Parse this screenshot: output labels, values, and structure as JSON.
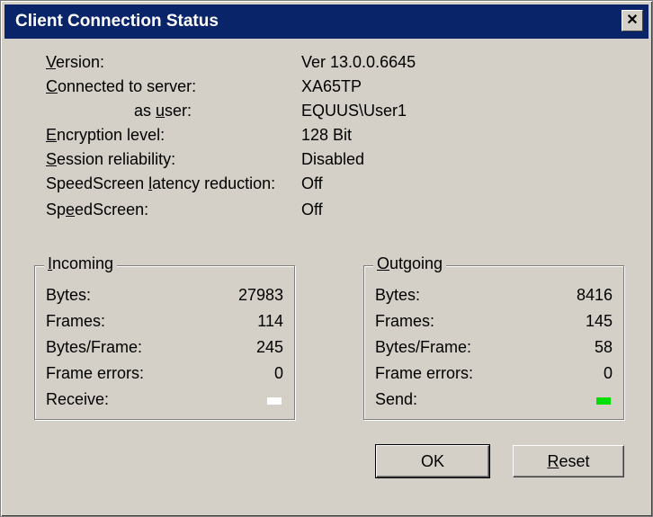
{
  "window": {
    "title": "Client Connection Status",
    "close_glyph": "✕"
  },
  "info": {
    "version": {
      "label_prefix": "",
      "label_ul": "V",
      "label_rest": "ersion:",
      "value": "Ver 13.0.0.6645"
    },
    "connected": {
      "label_ul": "C",
      "label_rest": "onnected to server:",
      "value": "XA65TP"
    },
    "user": {
      "label_pre": "as ",
      "label_ul": "u",
      "label_rest": "ser:",
      "value": "EQUUS\\User1"
    },
    "encryption": {
      "label_ul": "E",
      "label_rest": "ncryption level:",
      "value": "128 Bit"
    },
    "reliability": {
      "label_ul": "S",
      "label_rest": "ession reliability:",
      "value": "Disabled"
    },
    "latency": {
      "label_pre": "SpeedScreen ",
      "label_ul": "l",
      "label_rest": "atency reduction:",
      "value": "Off"
    },
    "speedscreen": {
      "label_pre": "Sp",
      "label_ul": "e",
      "label_rest": "edScreen:",
      "value": "Off"
    }
  },
  "incoming": {
    "title_ul": "I",
    "title_rest": "ncoming",
    "bytes_label": "Bytes:",
    "bytes": "27983",
    "frames_label": "Frames:",
    "frames": "114",
    "bpf_label": "Bytes/Frame:",
    "bpf": "245",
    "errors_label": "Frame errors:",
    "errors": "0",
    "receive_label": "Receive:",
    "indicator_color": "#ffffff"
  },
  "outgoing": {
    "title_ul": "O",
    "title_rest": "utgoing",
    "bytes_label": "Bytes:",
    "bytes": "8416",
    "frames_label": "Frames:",
    "frames": "145",
    "bpf_label": "Bytes/Frame:",
    "bpf": "58",
    "errors_label": "Frame errors:",
    "errors": "0",
    "send_label": "Send:",
    "indicator_color": "#00e000"
  },
  "buttons": {
    "ok": "OK",
    "reset_ul": "R",
    "reset_rest": "eset"
  }
}
